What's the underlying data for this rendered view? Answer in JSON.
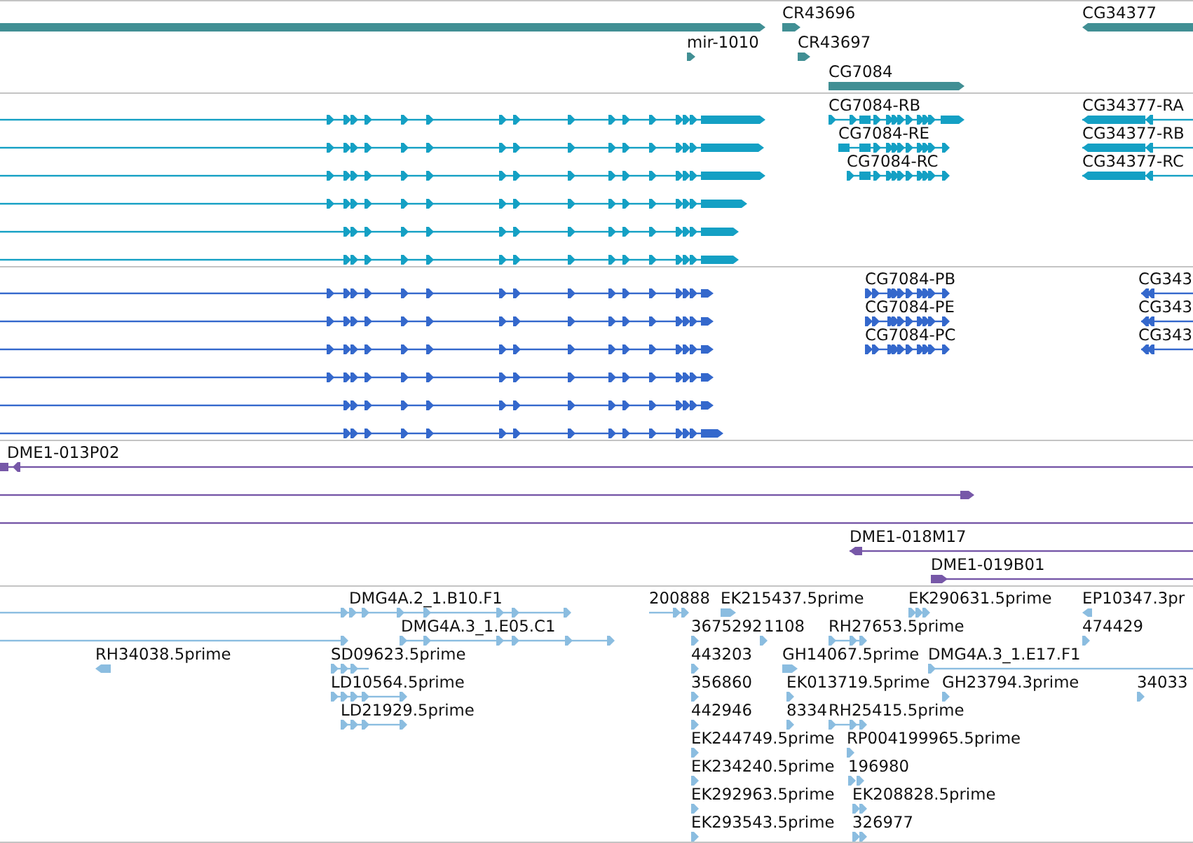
{
  "tracks": [
    {
      "kind": "gene",
      "features": [
        {
          "reverse": false
        },
        {
          "label": "CR43696",
          "reverse": false
        },
        {
          "label": "CG34377",
          "reverse": true
        },
        {
          "label": "mir-1010",
          "reverse": false
        },
        {
          "label": "CR43697",
          "reverse": false
        },
        {
          "label": "CG7084",
          "reverse": false
        }
      ]
    },
    {
      "kind": "transcript",
      "features": [
        {
          "reverse": false
        },
        {
          "label": "CG7084-RB",
          "reverse": false
        },
        {
          "label": "CG34377-RA",
          "reverse": true
        },
        {
          "reverse": false
        },
        {
          "label": "CG7084-RE",
          "reverse": false
        },
        {
          "label": "CG34377-RB",
          "reverse": true
        },
        {
          "reverse": false
        },
        {
          "label": "CG7084-RC",
          "reverse": false
        },
        {
          "label": "CG34377-RC",
          "reverse": true
        },
        {
          "reverse": false
        },
        {
          "reverse": false
        },
        {
          "reverse": false
        }
      ]
    },
    {
      "kind": "protein",
      "features": [
        {
          "reverse": false
        },
        {
          "label": "CG7084-PB",
          "reverse": false
        },
        {
          "label": "CG343",
          "reverse": true
        },
        {
          "reverse": false
        },
        {
          "label": "CG7084-PE",
          "reverse": false
        },
        {
          "label": "CG343",
          "reverse": true
        },
        {
          "reverse": false
        },
        {
          "label": "CG7084-PC",
          "reverse": false
        },
        {
          "label": "CG343",
          "reverse": true
        },
        {
          "reverse": false
        },
        {
          "reverse": false
        },
        {
          "reverse": false
        }
      ]
    },
    {
      "kind": "clone",
      "features": [
        {
          "kind": "arrow",
          "label": "DME1-013P02",
          "reverse": true
        },
        {
          "kind": "arrow",
          "reverse": false
        },
        {
          "kind": "line"
        },
        {
          "kind": "arrow",
          "label": "DME1-018M17",
          "reverse": true
        },
        {
          "kind": "arrow",
          "label": "DME1-019B01",
          "reverse": false
        }
      ]
    },
    {
      "kind": "est",
      "features": [
        {
          "label": "DMG4A.2_1.B10.F1",
          "reverse": false
        },
        {
          "label": "200888",
          "reverse": false
        },
        {
          "label": "EK215437.5prime",
          "reverse": false
        },
        {
          "label": "EK290631.5prime",
          "reverse": false
        },
        {
          "label": "EP10347.3pr",
          "reverse": true
        },
        {
          "reverse": false
        },
        {
          "label": "DMG4A.3_1.E05.C1",
          "reverse": false
        },
        {
          "label": "3675292",
          "reverse": false
        },
        {
          "label": "1108",
          "reverse": false
        },
        {
          "label": "RH27653.5prime",
          "reverse": false
        },
        {
          "label": "474429",
          "reverse": false
        },
        {
          "label": "RH34038.5prime",
          "reverse": true
        },
        {
          "label": "SD09623.5prime",
          "reverse": false
        },
        {
          "label": "443203",
          "reverse": false
        },
        {
          "label": "GH14067.5prime",
          "reverse": false
        },
        {
          "label": "DMG4A.3_1.E17.F1",
          "reverse": false
        },
        {
          "label": "LD10564.5prime",
          "reverse": false
        },
        {
          "label": "356860",
          "reverse": false
        },
        {
          "label": "EK013719.5prime",
          "reverse": false
        },
        {
          "label": "GH23794.3prime",
          "reverse": false
        },
        {
          "label": "34033",
          "reverse": false
        },
        {
          "label": "LD21929.5prime",
          "reverse": false
        },
        {
          "label": "442946",
          "reverse": false
        },
        {
          "label": "8334",
          "reverse": false
        },
        {
          "label": "RH25415.5prime",
          "reverse": false
        },
        {
          "label": "EK244749.5prime",
          "reverse": false
        },
        {
          "label": "RP004199965.5prime",
          "reverse": false
        },
        {
          "label": "EK234240.5prime",
          "reverse": false
        },
        {
          "label": "196980",
          "reverse": false
        },
        {
          "label": "EK292963.5prime",
          "reverse": false
        },
        {
          "label": "EK208828.5prime",
          "reverse": false
        },
        {
          "label": "EK293543.5prime",
          "reverse": false
        },
        {
          "label": "326977",
          "reverse": false
        }
      ]
    }
  ]
}
